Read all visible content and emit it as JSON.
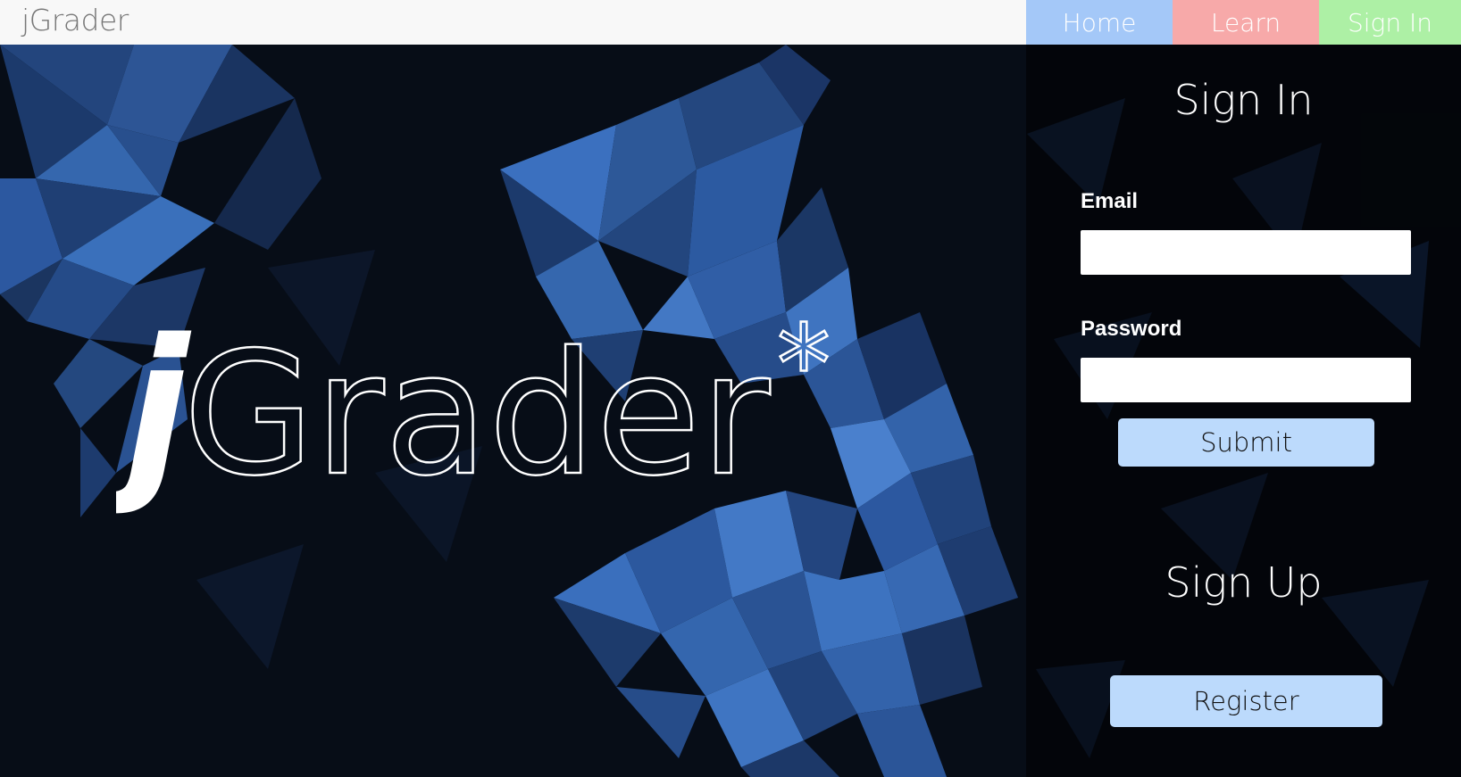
{
  "header": {
    "brand": "jGrader",
    "nav": [
      {
        "label": "Home",
        "color": "#a4c8f8"
      },
      {
        "label": "Learn",
        "color": "#f7a9a9"
      },
      {
        "label": "Sign In",
        "color": "#adf0a5"
      }
    ]
  },
  "hero": {
    "logo_initial": "j",
    "logo_rest": "Grader",
    "logo_mark": "*"
  },
  "signin": {
    "title": "Sign In",
    "email_label": "Email",
    "email_value": "",
    "password_label": "Password",
    "password_value": "",
    "submit_label": "Submit"
  },
  "signup": {
    "title": "Sign Up",
    "register_label": "Register"
  },
  "colors": {
    "background": "#070d17",
    "accent_blue": "#3a6db5",
    "button": "#bcdafc"
  }
}
